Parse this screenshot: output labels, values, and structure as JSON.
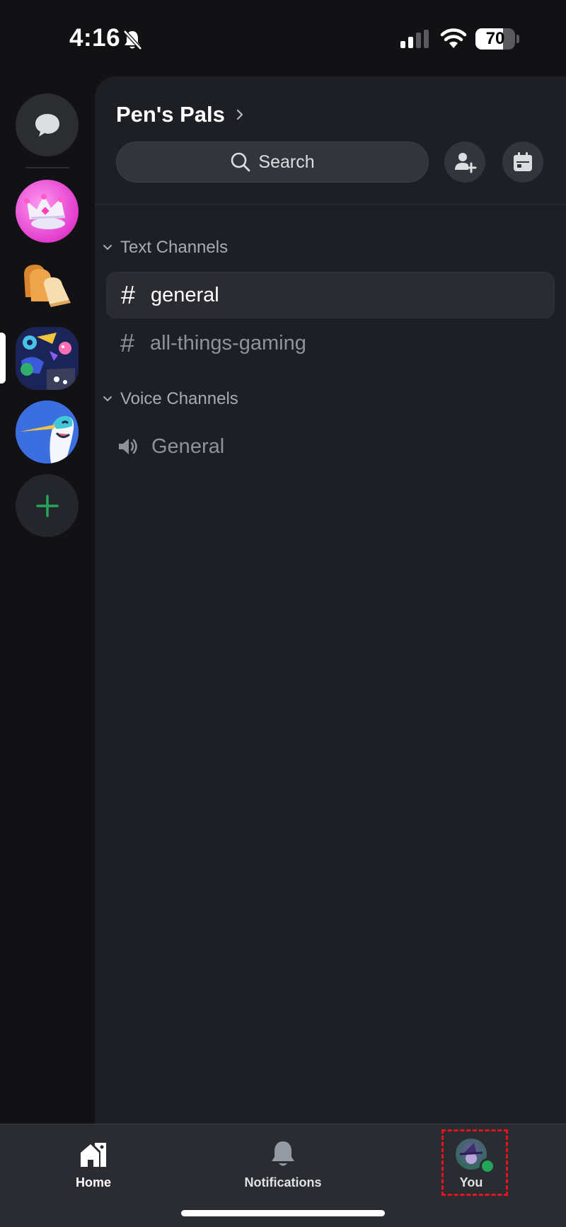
{
  "status_bar": {
    "time": "4:16",
    "battery": "70",
    "battery_fraction": 0.7
  },
  "server_rail": {
    "items": [
      {
        "name": "direct-messages",
        "icon": "chat-bubble-icon"
      },
      {
        "name": "server-crown",
        "icon": "crown-icon"
      },
      {
        "name": "server-bread",
        "icon": "bread-icon"
      },
      {
        "name": "server-gaming-art",
        "icon": "gaming-art-icon"
      },
      {
        "name": "server-bird",
        "icon": "bird-icon"
      },
      {
        "name": "add-server",
        "icon": "plus-icon"
      }
    ]
  },
  "server": {
    "name": "Pen's Pals"
  },
  "search": {
    "label": "Search"
  },
  "categories": {
    "text": "Text Channels",
    "voice": "Voice Channels"
  },
  "channels": {
    "general": "general",
    "gaming": "all-things-gaming",
    "voice_general": "General"
  },
  "bottom_nav": {
    "home": "Home",
    "notifications": "Notifications",
    "you": "You"
  },
  "colors": {
    "accent_green": "#23a55a",
    "highlight_red": "#e5141e"
  }
}
